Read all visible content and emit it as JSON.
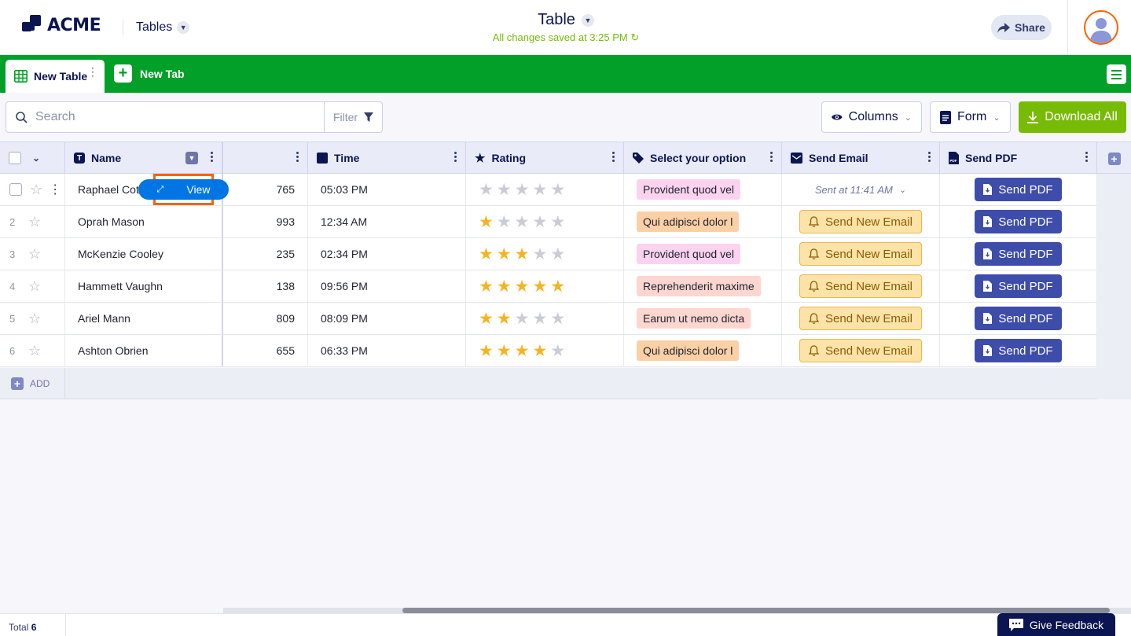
{
  "header": {
    "logo_text": "ACME",
    "tables_label": "Tables",
    "title": "Table",
    "saved_status": "All changes saved at 3:25 PM",
    "share_label": "Share"
  },
  "tabs": {
    "active_label": "New Table",
    "new_tab_label": "New Tab"
  },
  "toolbar": {
    "search_placeholder": "Search",
    "filter_label": "Filter",
    "columns_label": "Columns",
    "form_label": "Form",
    "download_label": "Download All"
  },
  "columns": {
    "name": "Name",
    "time": "Time",
    "rating": "Rating",
    "option": "Select your option",
    "email": "Send Email",
    "pdf": "Send PDF"
  },
  "rows": [
    {
      "index": "",
      "name": "Raphael Cotton",
      "number": "765",
      "time": "05:03 PM",
      "rating": 0,
      "option": "Provident quod vel",
      "option_color": "#fbd3ef",
      "email_sent": "Sent at 11:41 AM",
      "pdf": "Send PDF"
    },
    {
      "index": "2",
      "name": "Oprah Mason",
      "number": "993",
      "time": "12:34 AM",
      "rating": 1,
      "option": "Qui adipisci dolor l",
      "option_color": "#fcd0a6",
      "email": "Send New Email",
      "pdf": "Send PDF"
    },
    {
      "index": "3",
      "name": "McKenzie Cooley",
      "number": "235",
      "time": "02:34 PM",
      "rating": 3,
      "option": "Provident quod vel",
      "option_color": "#fbd3ef",
      "email": "Send New Email",
      "pdf": "Send PDF"
    },
    {
      "index": "4",
      "name": "Hammett Vaughn",
      "number": "138",
      "time": "09:56 PM",
      "rating": 5,
      "option": "Reprehenderit maxime",
      "option_color": "#fdd6d0",
      "email": "Send New Email",
      "pdf": "Send PDF"
    },
    {
      "index": "5",
      "name": "Ariel Mann",
      "number": "809",
      "time": "08:09 PM",
      "rating": 2,
      "option": "Earum ut nemo dicta",
      "option_color": "#fdd6d0",
      "email": "Send New Email",
      "pdf": "Send PDF"
    },
    {
      "index": "6",
      "name": "Ashton Obrien",
      "number": "655",
      "time": "06:33 PM",
      "rating": 4,
      "option": "Qui adipisci dolor l",
      "option_color": "#fcd0a6",
      "email": "Send New Email",
      "pdf": "Send PDF"
    }
  ],
  "view_label": "View",
  "add_label": "ADD",
  "footer": {
    "total_label": "Total",
    "total_count": "6",
    "feedback_label": "Give Feedback"
  },
  "colors": {
    "brand_green": "#02a029",
    "download_green": "#78bb07",
    "navy": "#0a1551",
    "pdf_blue": "#3e4caa",
    "view_blue": "#0075e3",
    "highlight_orange": "#ff6100",
    "star_gold": "#f5b324"
  }
}
